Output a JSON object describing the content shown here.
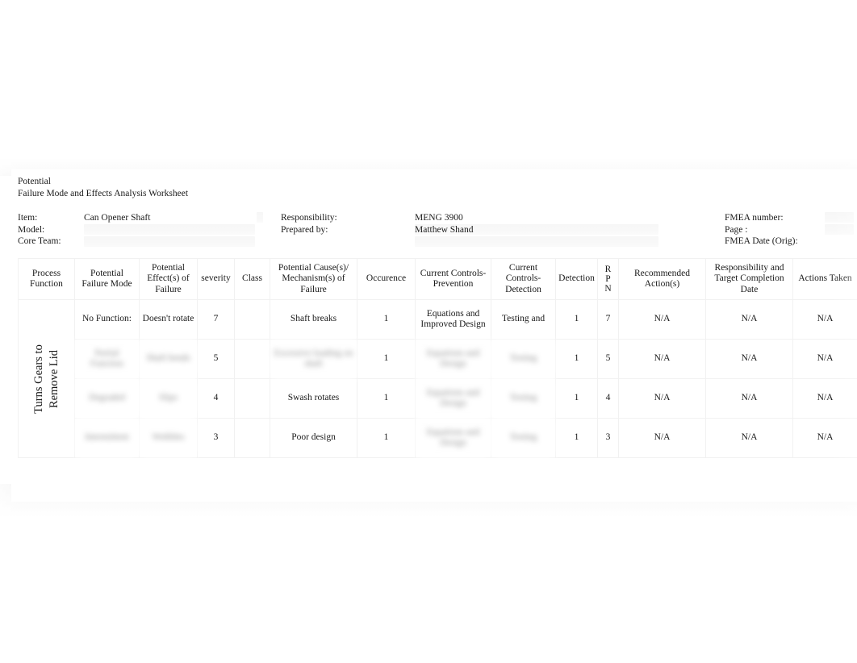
{
  "document": {
    "title_line1": "Potential",
    "title_line2": "Failure Mode and Effects Analysis Worksheet"
  },
  "meta": {
    "labels_left": {
      "item": "Item:",
      "model": "Model:",
      "core_team": "Core Team:"
    },
    "values_left": {
      "item": "Can Opener Shaft",
      "model": "",
      "core_team": ""
    },
    "labels_mid": {
      "responsibility": "Responsibility:",
      "prepared_by": "Prepared by:"
    },
    "values_mid": {
      "responsibility": "MENG 3900",
      "prepared_by": "Matthew Shand"
    },
    "labels_right": {
      "fmea_number": "FMEA number:",
      "page": "Page :",
      "fmea_date": "FMEA Date (Orig):"
    }
  },
  "table": {
    "headers": {
      "process_function": "Process Function",
      "potential_failure_mode": "Potential Failure Mode",
      "potential_effects": "Potential Effect(s) of Failure",
      "severity": "severity",
      "class": "Class",
      "potential_causes": "Potential Cause(s)/ Mechanism(s) of Failure",
      "occurence": "Occurence",
      "controls_prevention": "Current Controls-Prevention",
      "controls_detection": "Current Controls-Detection",
      "detection": "Detection",
      "rpn_r": "R",
      "rpn_p": "P",
      "rpn_n": "N",
      "recommended_action": "Recommended Action(s)",
      "responsibility_target": "Responsibility and Target Completion Date",
      "actions_taken": "Actions Taken"
    },
    "process_function_vertical": {
      "line1": "Turns Gears to",
      "line2": "Remove Lid"
    },
    "rows": [
      {
        "failure_mode": "No Function:",
        "effects": "Doesn't rotate",
        "severity": "7",
        "class": "",
        "causes": "Shaft breaks",
        "occurence": "1",
        "controls_prevention": "Equations and Improved Design",
        "controls_detection": "Testing and",
        "detection": "1",
        "rpn": "7",
        "recommended_action": "N/A",
        "responsibility_target": "N/A",
        "actions_taken": "N/A",
        "blurred": {
          "failure_mode": false,
          "effects": false,
          "causes": false,
          "controls_prevention": false,
          "controls_detection": false
        }
      },
      {
        "failure_mode": "Partial Function",
        "effects": "Shaft bends",
        "severity": "5",
        "class": "",
        "causes": "Excessive loading on shaft",
        "occurence": "1",
        "controls_prevention": "Equations and Design",
        "controls_detection": "Testing",
        "detection": "1",
        "rpn": "5",
        "recommended_action": "N/A",
        "responsibility_target": "N/A",
        "actions_taken": "N/A",
        "blurred": {
          "failure_mode": true,
          "effects": true,
          "causes": true,
          "controls_prevention": true,
          "controls_detection": true
        }
      },
      {
        "failure_mode": "Degraded",
        "effects": "Slips",
        "severity": "4",
        "class": "",
        "causes": "Swash rotates",
        "occurence": "1",
        "controls_prevention": "Equations and Design",
        "controls_detection": "Testing",
        "detection": "1",
        "rpn": "4",
        "recommended_action": "N/A",
        "responsibility_target": "N/A",
        "actions_taken": "N/A",
        "blurred": {
          "failure_mode": true,
          "effects": true,
          "causes": false,
          "controls_prevention": true,
          "controls_detection": true
        }
      },
      {
        "failure_mode": "Intermittent",
        "effects": "Wobbles",
        "severity": "3",
        "class": "",
        "causes": "Poor design",
        "occurence": "1",
        "controls_prevention": "Equations and Design",
        "controls_detection": "Testing",
        "detection": "1",
        "rpn": "3",
        "recommended_action": "N/A",
        "responsibility_target": "N/A",
        "actions_taken": "N/A",
        "blurred": {
          "failure_mode": true,
          "effects": true,
          "causes": false,
          "controls_prevention": true,
          "controls_detection": true
        }
      }
    ]
  }
}
